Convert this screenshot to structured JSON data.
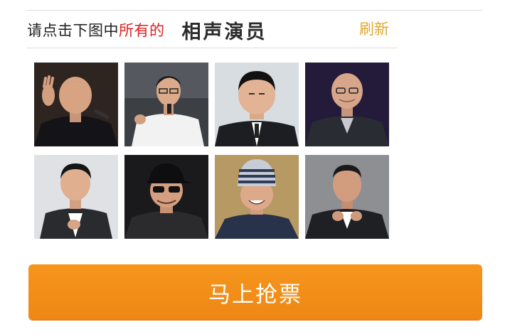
{
  "captcha": {
    "prompt_lead": "请点击下图中",
    "prompt_highlight": "所有的",
    "target_label": "相声演员",
    "refresh_label": "刷新",
    "tiles": [
      {
        "icon": "portrait-icon",
        "row": 1,
        "col": 1
      },
      {
        "icon": "portrait-icon",
        "row": 1,
        "col": 2
      },
      {
        "icon": "portrait-icon",
        "row": 1,
        "col": 3
      },
      {
        "icon": "portrait-icon",
        "row": 1,
        "col": 4
      },
      {
        "icon": "portrait-icon",
        "row": 2,
        "col": 1
      },
      {
        "icon": "portrait-icon",
        "row": 2,
        "col": 2
      },
      {
        "icon": "portrait-icon",
        "row": 2,
        "col": 3
      },
      {
        "icon": "portrait-icon",
        "row": 2,
        "col": 4
      }
    ]
  },
  "actions": {
    "buy_ticket_label": "马上抢票"
  },
  "colors": {
    "highlight": "#e02020",
    "refresh": "#e0a82a",
    "button": "#f28c18"
  }
}
